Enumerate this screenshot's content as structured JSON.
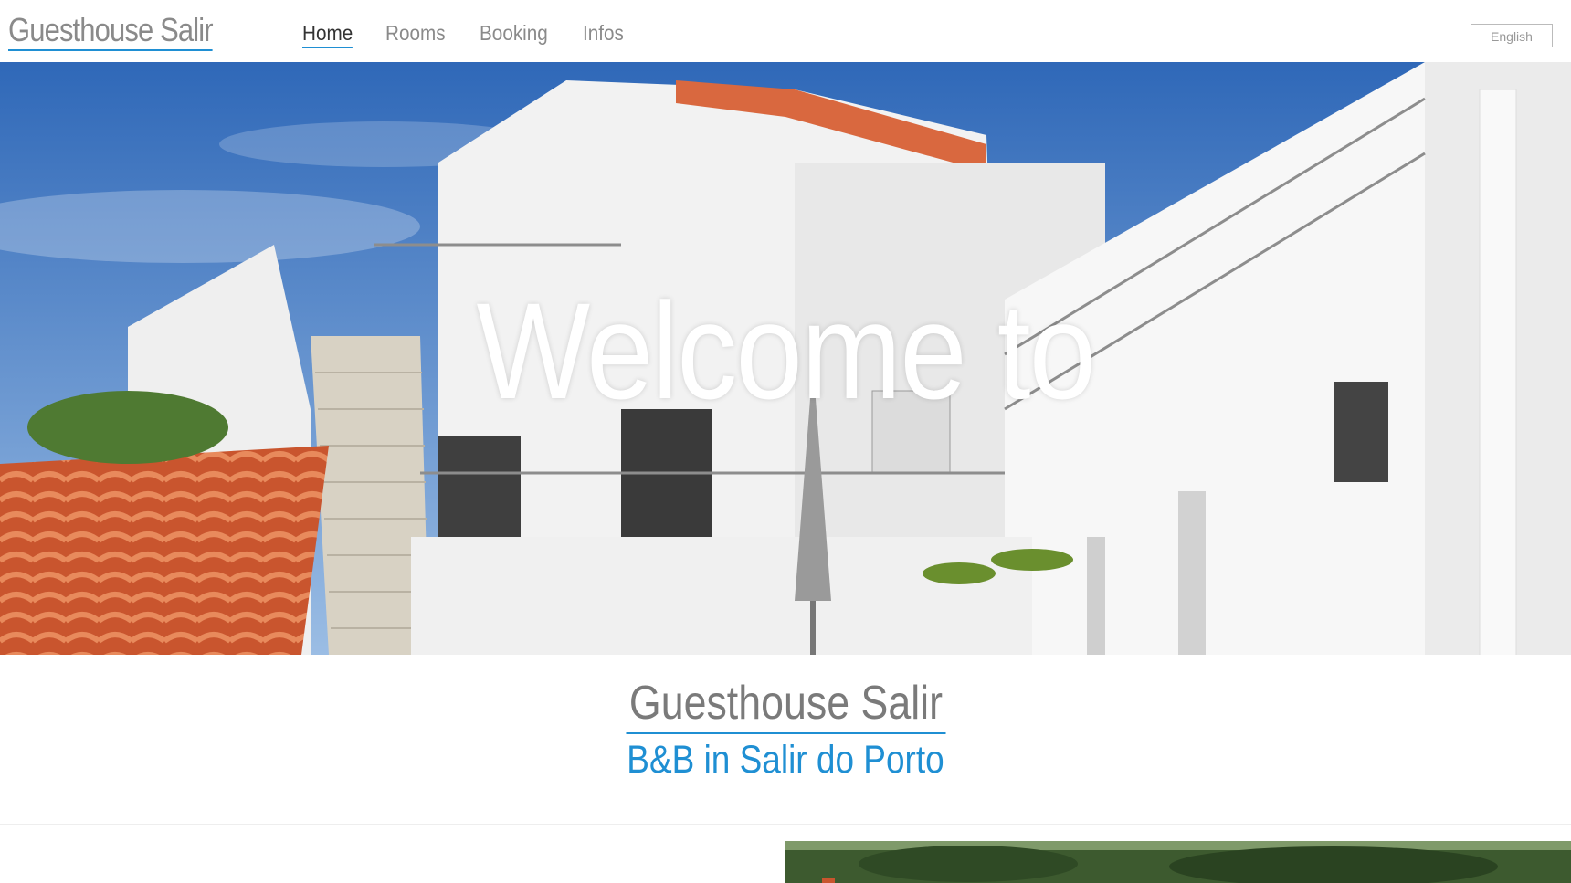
{
  "header": {
    "brand": "Guesthouse Salir",
    "nav": [
      "Home",
      "Rooms",
      "Booking",
      "Infos"
    ],
    "active": "Home",
    "language": "English"
  },
  "hero": {
    "title": "Welcome to"
  },
  "intro": {
    "title": "Guesthouse Salir",
    "subtitle": "B&B in Salir do Porto"
  },
  "colors": {
    "accent": "#1f8fd3",
    "text_gray": "#7a7a7a"
  }
}
